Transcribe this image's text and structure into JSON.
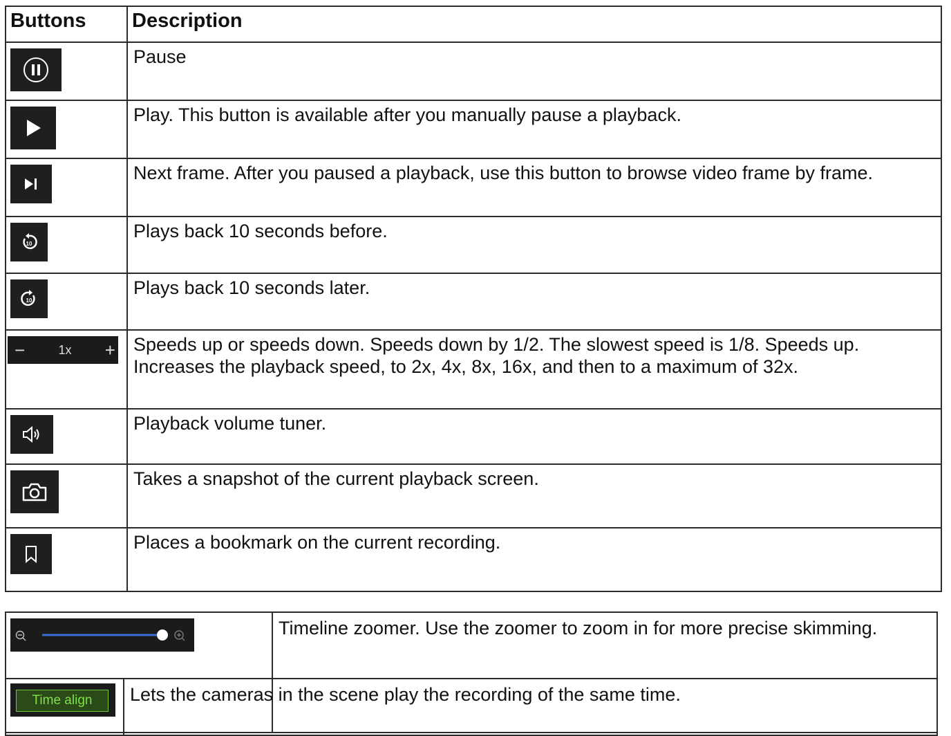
{
  "headers": {
    "buttons": "Buttons",
    "description": "Description"
  },
  "rows": [
    {
      "icon": "pause-icon",
      "description": "Pause"
    },
    {
      "icon": "play-icon",
      "description": "Play. This button is available after you manually pause a playback."
    },
    {
      "icon": "next-frame-icon",
      "description": "Next frame. After you paused a playback, use this button to browse video frame by frame."
    },
    {
      "icon": "rewind-10-icon",
      "description": "Plays back 10 seconds before."
    },
    {
      "icon": "forward-10-icon",
      "description": "Plays back 10 seconds later."
    },
    {
      "icon": "speed-control",
      "description": "Speeds up or speeds down. Speeds down by 1/2. The slowest speed is 1/8. Speeds up. Increases the playback speed, to 2x, 4x, 8x, 16x, and then to a maximum of 32x."
    },
    {
      "icon": "volume-icon",
      "description": "Playback volume tuner."
    },
    {
      "icon": "camera-icon",
      "description": "Takes a snapshot of the current playback screen."
    },
    {
      "icon": "bookmark-icon",
      "description": "Places a bookmark on the current recording."
    }
  ],
  "speed_control": {
    "minus": "−",
    "value": "1x",
    "plus": "+"
  },
  "second_table": [
    {
      "icon": "timeline-zoomer",
      "description": "Timeline zoomer. Use the zoomer to zoom in for more precise skimming."
    },
    {
      "icon": "time-align-button",
      "label": "Time align",
      "description": "Lets the cameras in the scene play the recording of the same time."
    }
  ],
  "colors": {
    "button_bg": "#1f1f1f",
    "zoom_track": "#3b6fd8",
    "time_align_text": "#7fe04a",
    "time_align_border": "#6fc93a"
  }
}
